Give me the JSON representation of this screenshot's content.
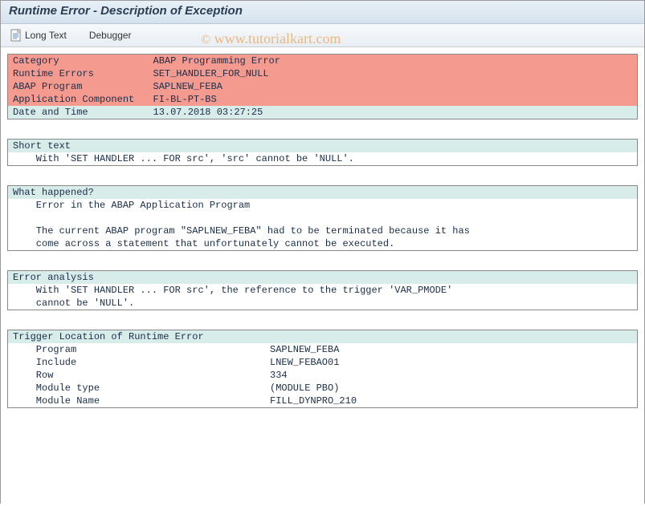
{
  "title": "Runtime Error - Description of Exception",
  "toolbar": {
    "long_text_label": "Long Text",
    "debugger_label": "Debugger"
  },
  "header": {
    "rows": [
      {
        "label": "Category",
        "value": "ABAP Programming Error"
      },
      {
        "label": "Runtime Errors",
        "value": "SET_HANDLER_FOR_NULL"
      },
      {
        "label": "ABAP Program",
        "value": "SAPLNEW_FEBA"
      },
      {
        "label": "Application Component",
        "value": "FI-BL-PT-BS"
      },
      {
        "label": "Date and Time",
        "value": "13.07.2018 03:27:25"
      }
    ]
  },
  "sections": {
    "short_text": {
      "title": "Short text",
      "line1": "    With 'SET HANDLER ... FOR src', 'src' cannot be 'NULL'."
    },
    "what_happened": {
      "title": "What happened?",
      "line1": "    Error in the ABAP Application Program",
      "line2": " ",
      "line3": "    The current ABAP program \"SAPLNEW_FEBA\" had to be terminated because it has",
      "line4": "    come across a statement that unfortunately cannot be executed."
    },
    "error_analysis": {
      "title": "Error analysis",
      "line1": "    With 'SET HANDLER ... FOR src', the reference to the trigger 'VAR_PMODE'",
      "line2": "    cannot be 'NULL'."
    },
    "trigger": {
      "title": "Trigger Location of Runtime Error",
      "rows": [
        {
          "label": "    Program",
          "value": "SAPLNEW_FEBA"
        },
        {
          "label": "    Include",
          "value": "LNEW_FEBAO01"
        },
        {
          "label": "    Row",
          "value": "334"
        },
        {
          "label": "    Module type",
          "value": "(MODULE PBO)"
        },
        {
          "label": "    Module Name",
          "value": "FILL_DYNPRO_210"
        }
      ]
    }
  },
  "watermark": {
    "copyright": "©",
    "text": " www.tutorialkart.com"
  }
}
